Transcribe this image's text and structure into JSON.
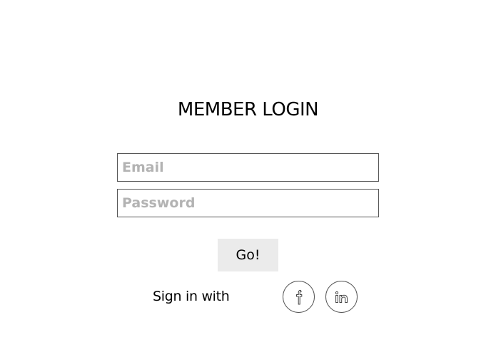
{
  "login": {
    "title": "MEMBER LOGIN",
    "email_placeholder": "Email",
    "password_placeholder": "Password",
    "submit_label": "Go!",
    "sign_in_with_label": "Sign in with"
  },
  "social": [
    {
      "icon": "facebook-icon"
    },
    {
      "icon": "linkedin-icon"
    }
  ],
  "colors": {
    "background": "#ffffff",
    "button_background": "#ebebeb",
    "placeholder": "#b3b3b3",
    "border": "#555555"
  }
}
